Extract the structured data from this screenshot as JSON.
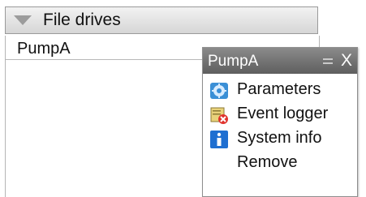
{
  "file_drives": {
    "header_title": "File drives",
    "drives": [
      {
        "name": "PumpA"
      }
    ]
  },
  "context_menu": {
    "title": "PumpA",
    "close_label": "X",
    "items": [
      {
        "label": "Parameters",
        "icon": "gear-icon"
      },
      {
        "label": "Event logger",
        "icon": "event-logger-icon"
      },
      {
        "label": "System info",
        "icon": "info-icon"
      },
      {
        "label": "Remove",
        "icon": ""
      }
    ]
  }
}
